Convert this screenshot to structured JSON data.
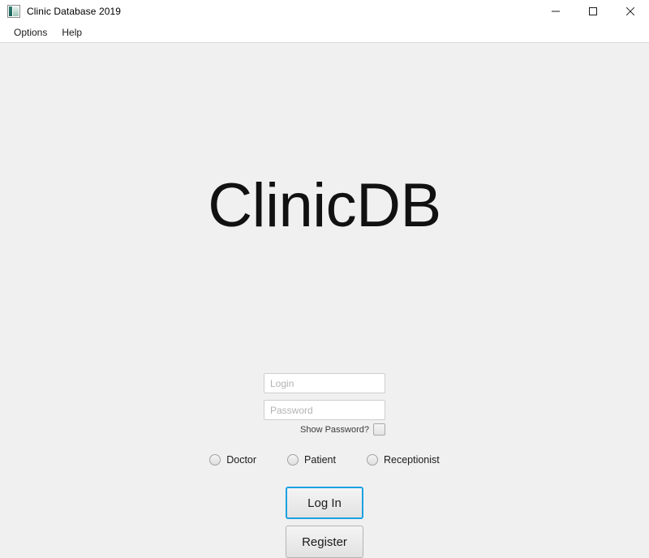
{
  "window": {
    "title": "Clinic Database 2019",
    "icon": "app-window-icon",
    "controls": [
      {
        "name": "minimize",
        "glyph": "minimize-icon"
      },
      {
        "name": "maximize",
        "glyph": "maximize-icon"
      },
      {
        "name": "close",
        "glyph": "close-icon"
      }
    ]
  },
  "menu": {
    "items": [
      {
        "label": "Options"
      },
      {
        "label": "Help"
      }
    ]
  },
  "brand": {
    "title": "ClinicDB"
  },
  "form": {
    "login": {
      "value": "",
      "placeholder": "Login"
    },
    "password": {
      "value": "",
      "placeholder": "Password"
    },
    "show_password": {
      "label": "Show Password?",
      "checked": false
    },
    "roles": [
      {
        "label": "Doctor",
        "selected": false
      },
      {
        "label": "Patient",
        "selected": false
      },
      {
        "label": "Receptionist",
        "selected": false
      }
    ],
    "buttons": {
      "login": "Log In",
      "register": "Register"
    }
  },
  "colors": {
    "focus_accent": "#1ba1e2",
    "window_background": "#f0f0f0",
    "titlebar_background": "#ffffff",
    "field_border": "#cdcdcd",
    "placeholder_text": "#b3b3b3"
  }
}
